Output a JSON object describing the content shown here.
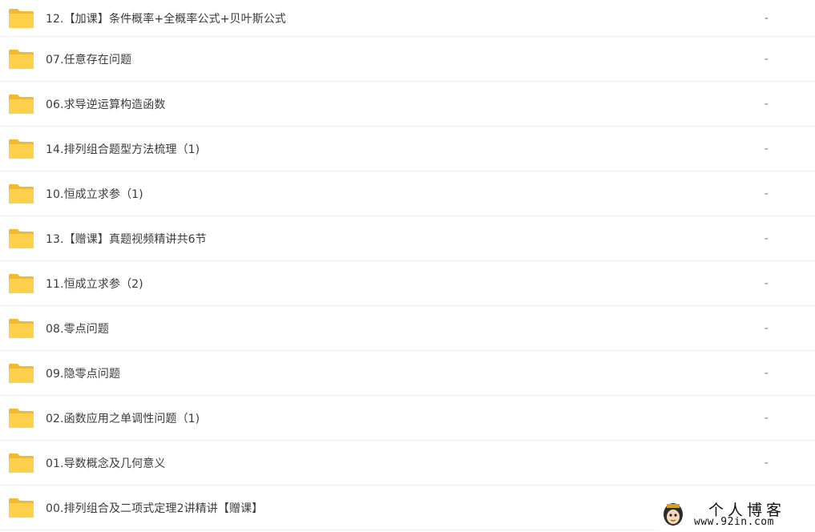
{
  "files": [
    {
      "name": "12.【加课】条件概率+全概率公式+贝叶斯公式",
      "size": "-"
    },
    {
      "name": "07.任意存在问题",
      "size": "-"
    },
    {
      "name": "06.求导逆运算构造函数",
      "size": "-"
    },
    {
      "name": "14.排列组合题型方法梳理（1)",
      "size": "-"
    },
    {
      "name": "10.恒成立求参（1)",
      "size": "-"
    },
    {
      "name": "13.【赠课】真题视频精讲共6节",
      "size": "-"
    },
    {
      "name": "11.恒成立求参（2)",
      "size": "-"
    },
    {
      "name": "08.零点问题",
      "size": "-"
    },
    {
      "name": "09.隐零点问题",
      "size": "-"
    },
    {
      "name": "02.函数应用之单调性问题（1)",
      "size": "-"
    },
    {
      "name": "01.导数概念及几何意义",
      "size": "-"
    },
    {
      "name": "00.排列组合及二项式定理2讲精讲【赠课】",
      "size": ""
    }
  ],
  "watermark": {
    "title": "个人博客",
    "url": "www.92in.com"
  },
  "colors": {
    "folder": "#ffd04b",
    "folder_tab": "#f2b92e",
    "text": "#3b3b3b",
    "divider": "#f0f0f0"
  },
  "icons": {
    "folder": "folder-icon",
    "watermark_face": "cartoon-face-icon"
  }
}
